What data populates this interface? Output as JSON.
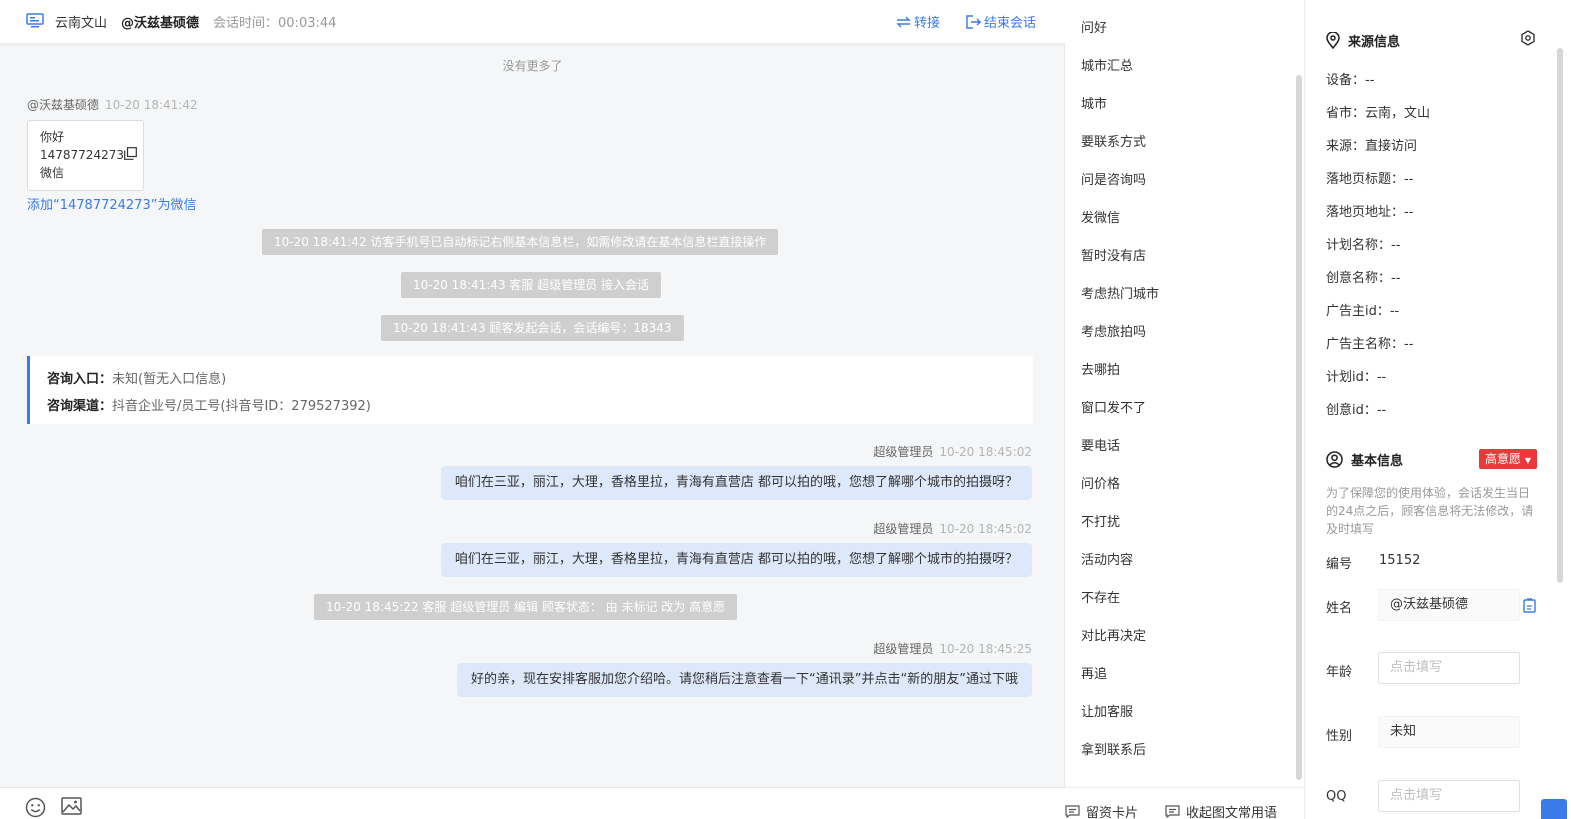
{
  "header": {
    "location": "云南文山",
    "visitor": "@沃兹基硕德",
    "session_time_label": "会话时间：",
    "session_time": "00:03:44",
    "transfer": "转接",
    "end_session": "结束会话"
  },
  "chat": {
    "no_more": "没有更多了",
    "visitor_msg": {
      "name": "@沃兹基硕德",
      "time": "10-20 18:41:42",
      "lines": [
        "你好",
        "14787724273",
        "微信"
      ]
    },
    "add_wechat": "添加“14787724273”为微信",
    "system": [
      "10-20 18:41:42 访客手机号已自动标记右侧基本信息栏，如需修改请在基本信息栏直接操作",
      "10-20 18:41:43 客服 超级管理员 接入会话",
      "10-20 18:41:43 顾客发起会话，会话编号：18343",
      "10-20 18:45:22 客服 超级管理员 编辑 顾客状态： 由 未标记 改为 高意愿"
    ],
    "source": {
      "entry_label": "咨询入口：",
      "entry_value": "未知(暂无入口信息)",
      "channel_label": "咨询渠道：",
      "channel_value": "抖音企业号/员工号(抖音号ID：279527392)"
    },
    "agent_messages": [
      {
        "name": "超级管理员",
        "time": "10-20 18:45:02",
        "text": "咱们在三亚，丽江，大理，香格里拉，青海有直营店 都可以拍的哦，您想了解哪个城市的拍摄呀？"
      },
      {
        "name": "超级管理员",
        "time": "10-20 18:45:02",
        "text": "咱们在三亚，丽江，大理，香格里拉，青海有直营店 都可以拍的哦，您想了解哪个城市的拍摄呀？"
      },
      {
        "name": "超级管理员",
        "time": "10-20 18:45:25",
        "text": "好的亲，现在安排客服加您介绍哈。请您稍后注意查看一下“通讯录”并点击“新的朋友”通过下哦"
      }
    ]
  },
  "quick_replies": {
    "items": [
      "问好",
      "城市汇总",
      "城市",
      "要联系方式",
      "问是咨询吗",
      "发微信",
      "暂时没有店",
      "考虑热门城市",
      "考虑旅拍吗",
      "去哪拍",
      "窗口发不了",
      "要电话",
      "问价格",
      "不打扰",
      "活动内容",
      "不存在",
      "对比再决定",
      "再追",
      "让加客服",
      "拿到联系后"
    ],
    "card_button": "留资卡片",
    "collapse_button": "收起图文常用语"
  },
  "source_info": {
    "title": "来源信息",
    "rows": [
      "设备：--",
      "省市：云南，文山",
      "来源：直接访问",
      "落地页标题：--",
      "落地页地址：--",
      "计划名称：--",
      "创意名称：--",
      "广告主id：--",
      "广告主名称：--",
      "计划id：--",
      "创意id：--"
    ]
  },
  "basic_info": {
    "title": "基本信息",
    "intent_badge": "高意愿",
    "notice": "为了保障您的使用体验，会话发生当日的24点之后，顾客信息将无法修改，请及时填写",
    "number_label": "编号",
    "number_value": "15152",
    "name_label": "姓名",
    "name_value": "@沃兹基硕德",
    "age_label": "年龄",
    "age_placeholder": "点击填写",
    "gender_label": "性别",
    "gender_value": "未知",
    "qq_label": "QQ",
    "qq_placeholder": "点击填写"
  },
  "colors": {
    "accent": "#3a7be9",
    "bubble": "#dde9fb",
    "system_bg": "#cfcfcf",
    "badge": "#e83a3a"
  }
}
